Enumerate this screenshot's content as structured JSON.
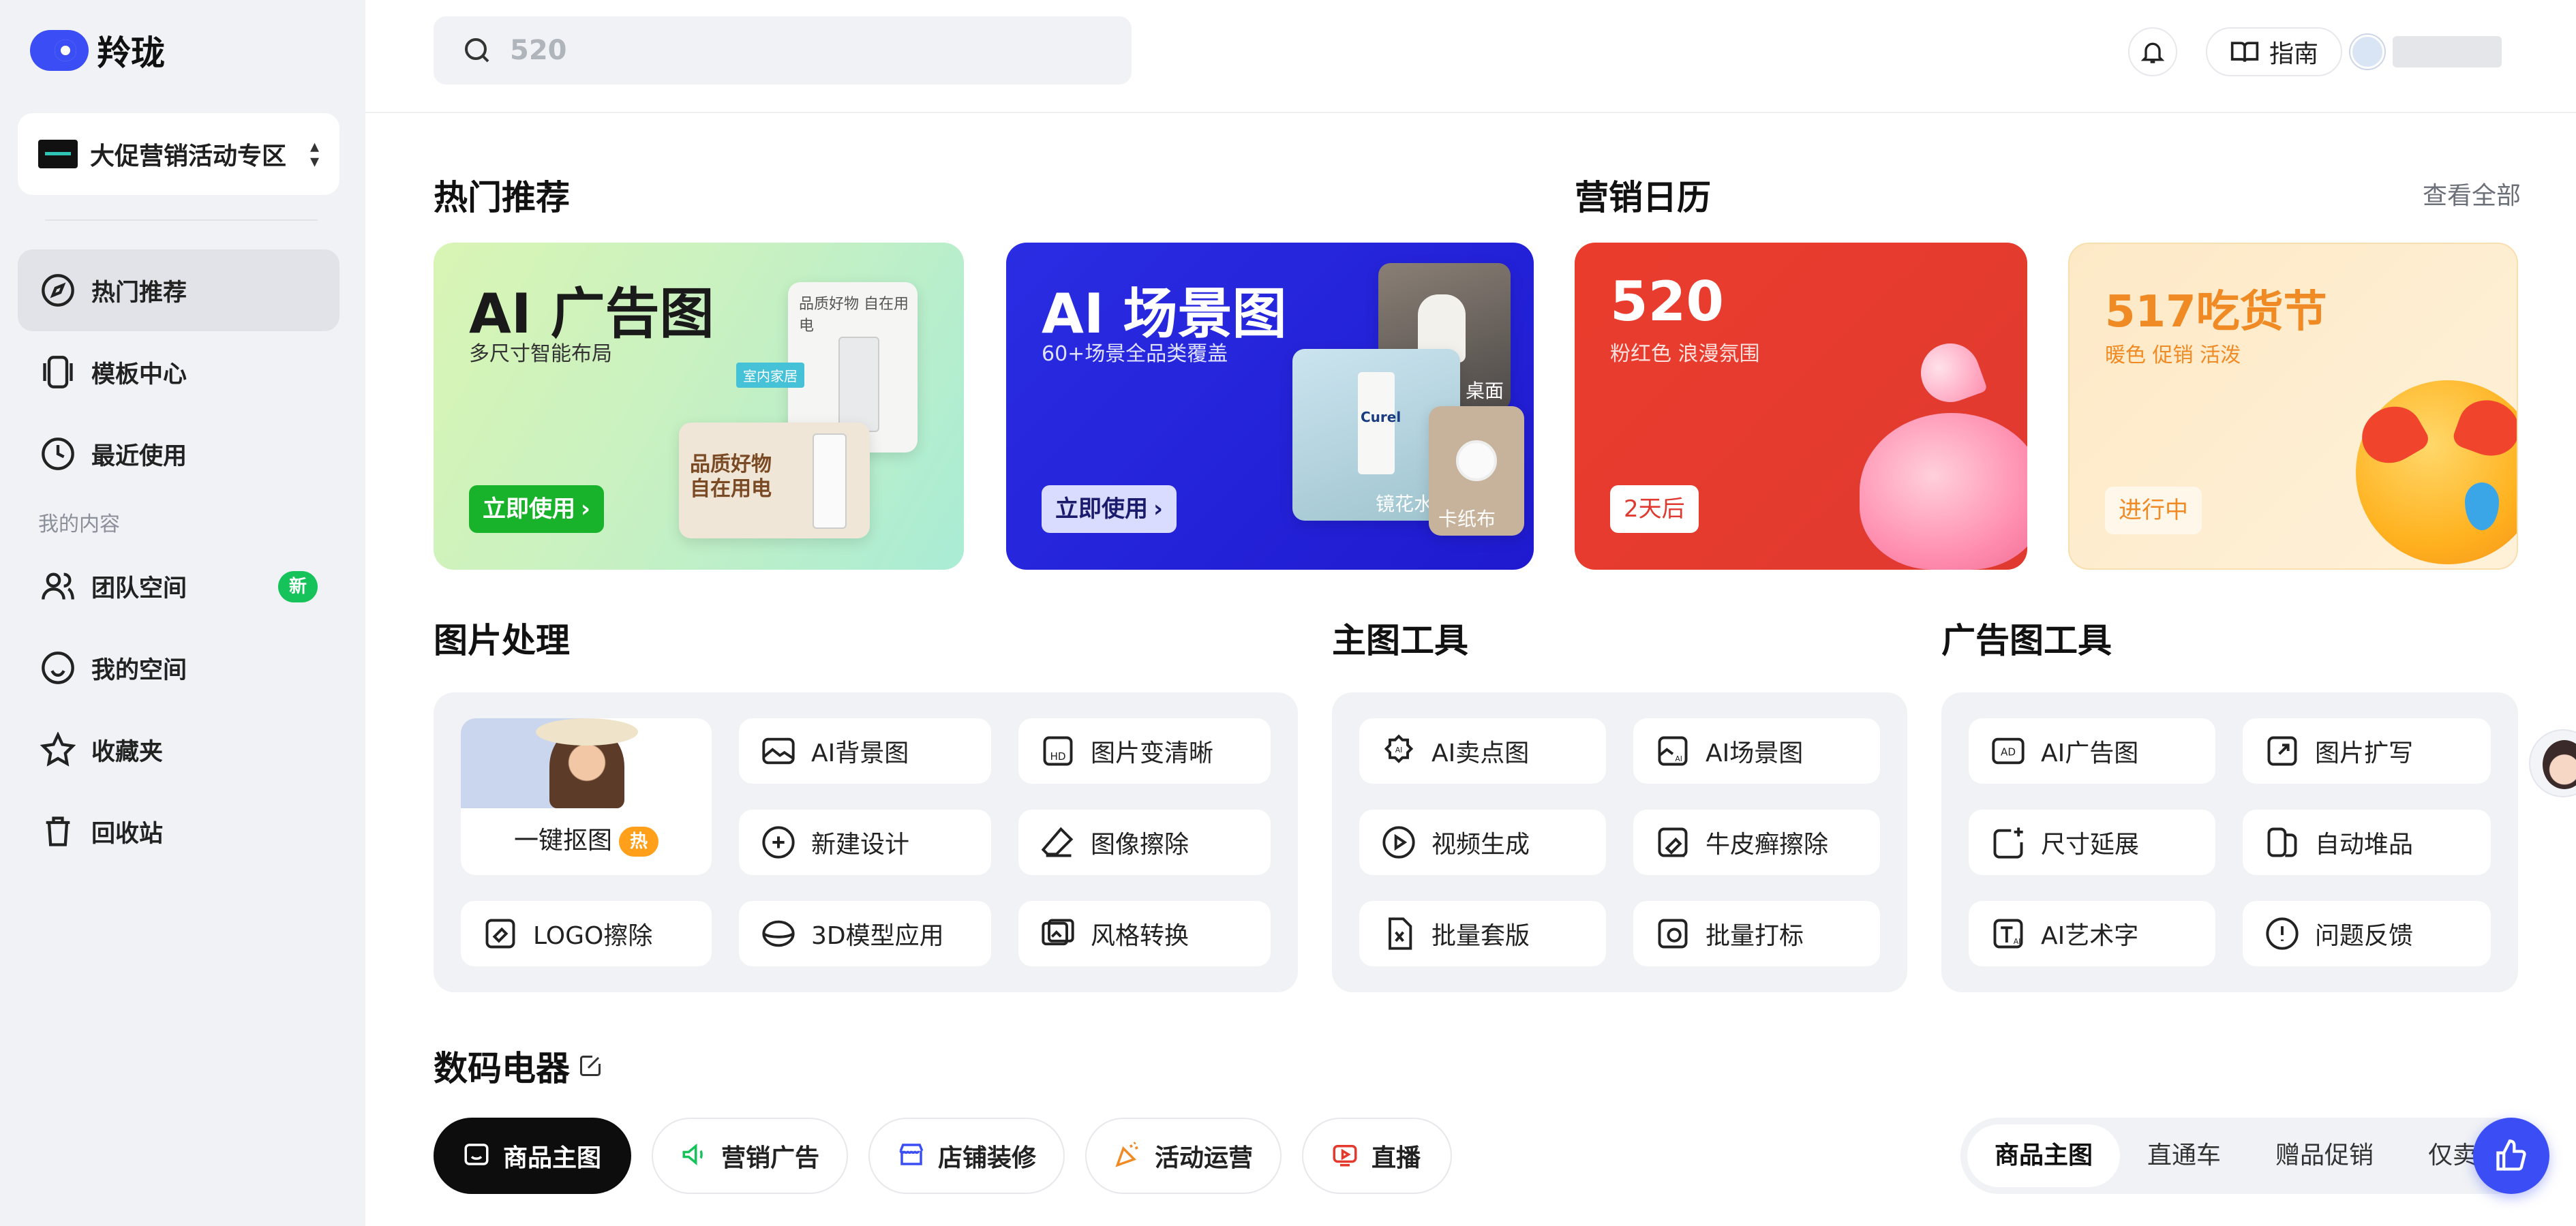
{
  "app": {
    "name": "羚珑"
  },
  "sidebar": {
    "space_label": "大促营销活动专区",
    "items": [
      {
        "label": "热门推荐",
        "icon": "compass-icon"
      },
      {
        "label": "模板中心",
        "icon": "template-icon"
      },
      {
        "label": "最近使用",
        "icon": "clock-icon"
      },
      {
        "label": "团队空间",
        "icon": "team-icon",
        "badge": "新"
      },
      {
        "label": "我的空间",
        "icon": "smile-icon"
      },
      {
        "label": "收藏夹",
        "icon": "star-icon"
      },
      {
        "label": "回收站",
        "icon": "trash-icon"
      }
    ],
    "section_label": "我的内容"
  },
  "header": {
    "search_value": "520",
    "guide_label": "指南"
  },
  "sections": {
    "hot": "热门推荐",
    "calendar": "营销日历",
    "see_all": "查看全部",
    "image_proc": "图片处理",
    "main_tools": "主图工具",
    "ad_tools": "广告图工具",
    "category": "数码电器"
  },
  "banners": [
    {
      "title": "AI 广告图",
      "sub": "多尺寸智能布局",
      "btn": "立即使用",
      "img1_text": "品质好物 自在用电",
      "img2_text": "品质好物\n自在用电",
      "tag": "室内家居"
    },
    {
      "title": "AI 场景图",
      "sub": "60+场景全品类覆盖",
      "btn": "立即使用",
      "tag1": "桌面",
      "tag2": "镜花水月",
      "tag3": "卡纸布",
      "product": "Curel"
    },
    {
      "title": "520",
      "sub": "粉红色 浪漫氛围",
      "btn": "2天后"
    },
    {
      "title": "517吃货节",
      "sub": "暖色 促销 活泼",
      "btn": "进行中"
    }
  ],
  "image_tools": {
    "cutout_label": "一键抠图",
    "hot_badge": "热",
    "tools": [
      {
        "label": "AI背景图",
        "icon": "ai-background-icon"
      },
      {
        "label": "图片变清晰",
        "icon": "hd-icon"
      },
      {
        "label": "新建设计",
        "icon": "plus-circle-icon"
      },
      {
        "label": "图像擦除",
        "icon": "eraser-icon"
      },
      {
        "label": "LOGO擦除",
        "icon": "logo-erase-icon"
      },
      {
        "label": "3D模型应用",
        "icon": "3d-model-icon"
      },
      {
        "label": "风格转换",
        "icon": "style-transfer-icon"
      }
    ]
  },
  "main_tools": [
    {
      "label": "AI卖点图",
      "icon": "ai-selling-icon"
    },
    {
      "label": "AI场景图",
      "icon": "ai-scene-icon"
    },
    {
      "label": "视频生成",
      "icon": "video-icon"
    },
    {
      "label": "牛皮癣擦除",
      "icon": "psoriasis-erase-icon"
    },
    {
      "label": "批量套版",
      "icon": "batch-template-icon"
    },
    {
      "label": "批量打标",
      "icon": "batch-tag-icon"
    }
  ],
  "ad_tools": [
    {
      "label": "AI广告图",
      "icon": "ad-icon"
    },
    {
      "label": "图片扩写",
      "icon": "expand-icon"
    },
    {
      "label": "尺寸延展",
      "icon": "resize-icon"
    },
    {
      "label": "自动堆品",
      "icon": "auto-stack-icon"
    },
    {
      "label": "AI艺术字",
      "icon": "art-text-icon"
    },
    {
      "label": "问题反馈",
      "icon": "feedback-icon"
    }
  ],
  "category_pills": [
    {
      "label": "商品主图",
      "icon": "image-icon"
    },
    {
      "label": "营销广告",
      "icon": "megaphone-icon"
    },
    {
      "label": "店铺装修",
      "icon": "store-icon"
    },
    {
      "label": "活动运营",
      "icon": "party-icon"
    },
    {
      "label": "直播",
      "icon": "live-icon"
    }
  ],
  "segment": [
    "商品主图",
    "直通车",
    "赠品促销",
    "仅卖点"
  ],
  "colors": {
    "brand": "#3b4ef5",
    "green": "#16c35a",
    "banner1_btn": "#19b32b",
    "banner2_bg": "#2420d8",
    "banner3_bg": "#e43a2e",
    "banner4_bg": "#fdeccb",
    "banner4_text": "#f08a24"
  }
}
